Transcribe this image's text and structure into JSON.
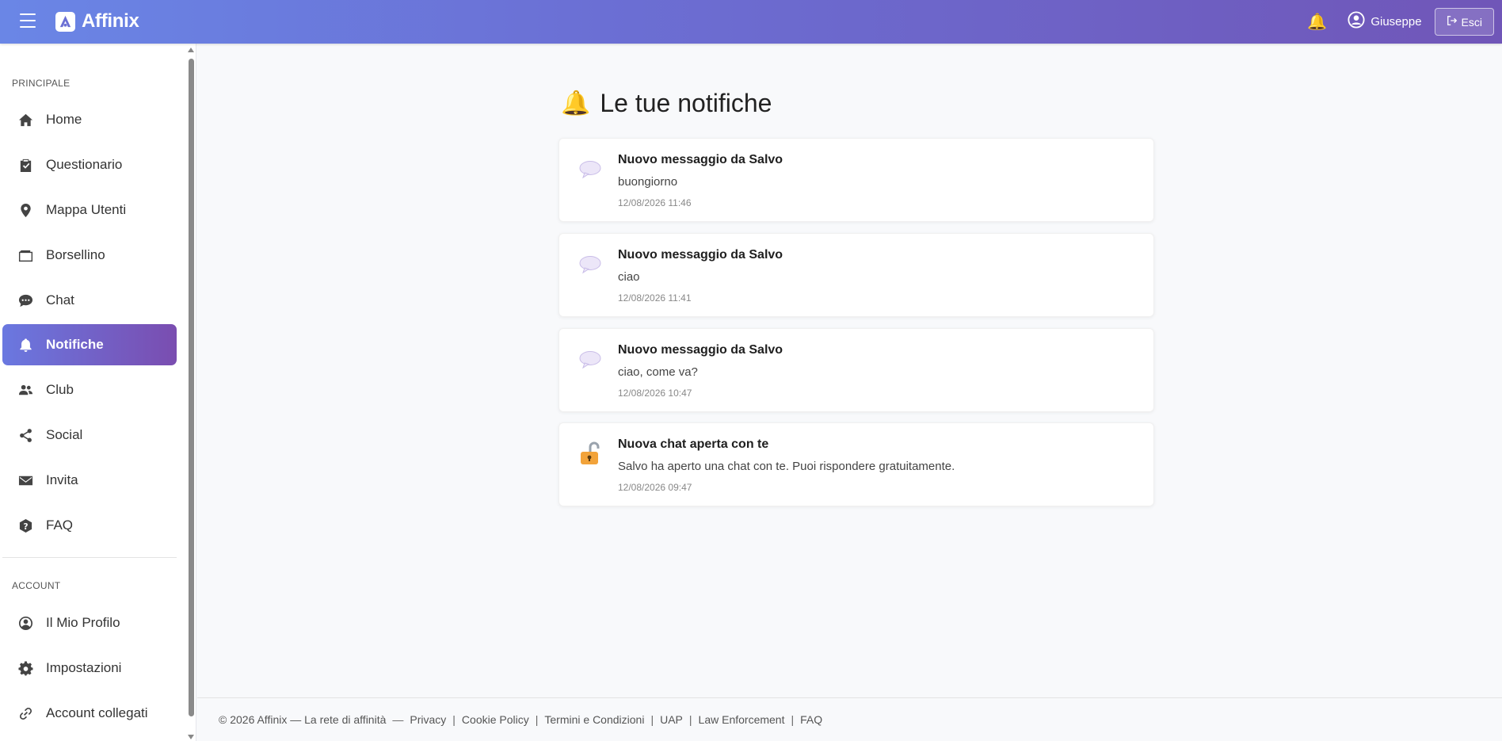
{
  "app": {
    "brand": "Affinix",
    "accent_start": "#6a86e6",
    "accent_end": "#7056b8"
  },
  "topbar": {
    "menu_icon": "hamburger-icon",
    "bell_icon": "bell-icon",
    "user_name": "Giuseppe",
    "logout_label": "Esci"
  },
  "sidebar": {
    "section_main": "PRINCIPALE",
    "main_items": [
      {
        "label": "Home",
        "icon": "home-icon"
      },
      {
        "label": "Questionario",
        "icon": "clipboard-icon"
      },
      {
        "label": "Mappa Utenti",
        "icon": "map-pin-icon"
      },
      {
        "label": "Borsellino",
        "icon": "wallet-icon"
      },
      {
        "label": "Chat",
        "icon": "chat-icon"
      },
      {
        "label": "Notifiche",
        "icon": "bell-icon",
        "active": true
      },
      {
        "label": "Club",
        "icon": "users-icon"
      },
      {
        "label": "Social",
        "icon": "share-icon"
      },
      {
        "label": "Invita",
        "icon": "envelope-icon"
      },
      {
        "label": "FAQ",
        "icon": "question-icon"
      }
    ],
    "section_account": "ACCOUNT",
    "account_items": [
      {
        "label": "Il Mio Profilo",
        "icon": "user-circle-icon"
      },
      {
        "label": "Impostazioni",
        "icon": "gear-icon"
      },
      {
        "label": "Account collegati",
        "icon": "link-icon"
      }
    ]
  },
  "main": {
    "title_emoji": "🔔",
    "title": "Le tue notifiche",
    "notifications": [
      {
        "icon": "speech-bubble-icon",
        "title": "Nuovo messaggio da Salvo",
        "body": "buongiorno",
        "time": "12/08/2026 11:46"
      },
      {
        "icon": "speech-bubble-icon",
        "title": "Nuovo messaggio da Salvo",
        "body": "ciao",
        "time": "12/08/2026 11:41"
      },
      {
        "icon": "speech-bubble-icon",
        "title": "Nuovo messaggio da Salvo",
        "body": "ciao, come va?",
        "time": "12/08/2026 10:47"
      },
      {
        "icon": "unlocked-icon",
        "title": "Nuova chat aperta con te",
        "body": "Salvo ha aperto una chat con te. Puoi rispondere gratuitamente.",
        "time": "12/08/2026 09:47"
      }
    ]
  },
  "footer": {
    "copyright": "© 2026 Affinix — La rete di affinità",
    "dash": "—",
    "pipe": "|",
    "links": [
      "Privacy",
      "Cookie Policy",
      "Termini e Condizioni",
      "UAP",
      "Law Enforcement",
      "FAQ"
    ]
  }
}
